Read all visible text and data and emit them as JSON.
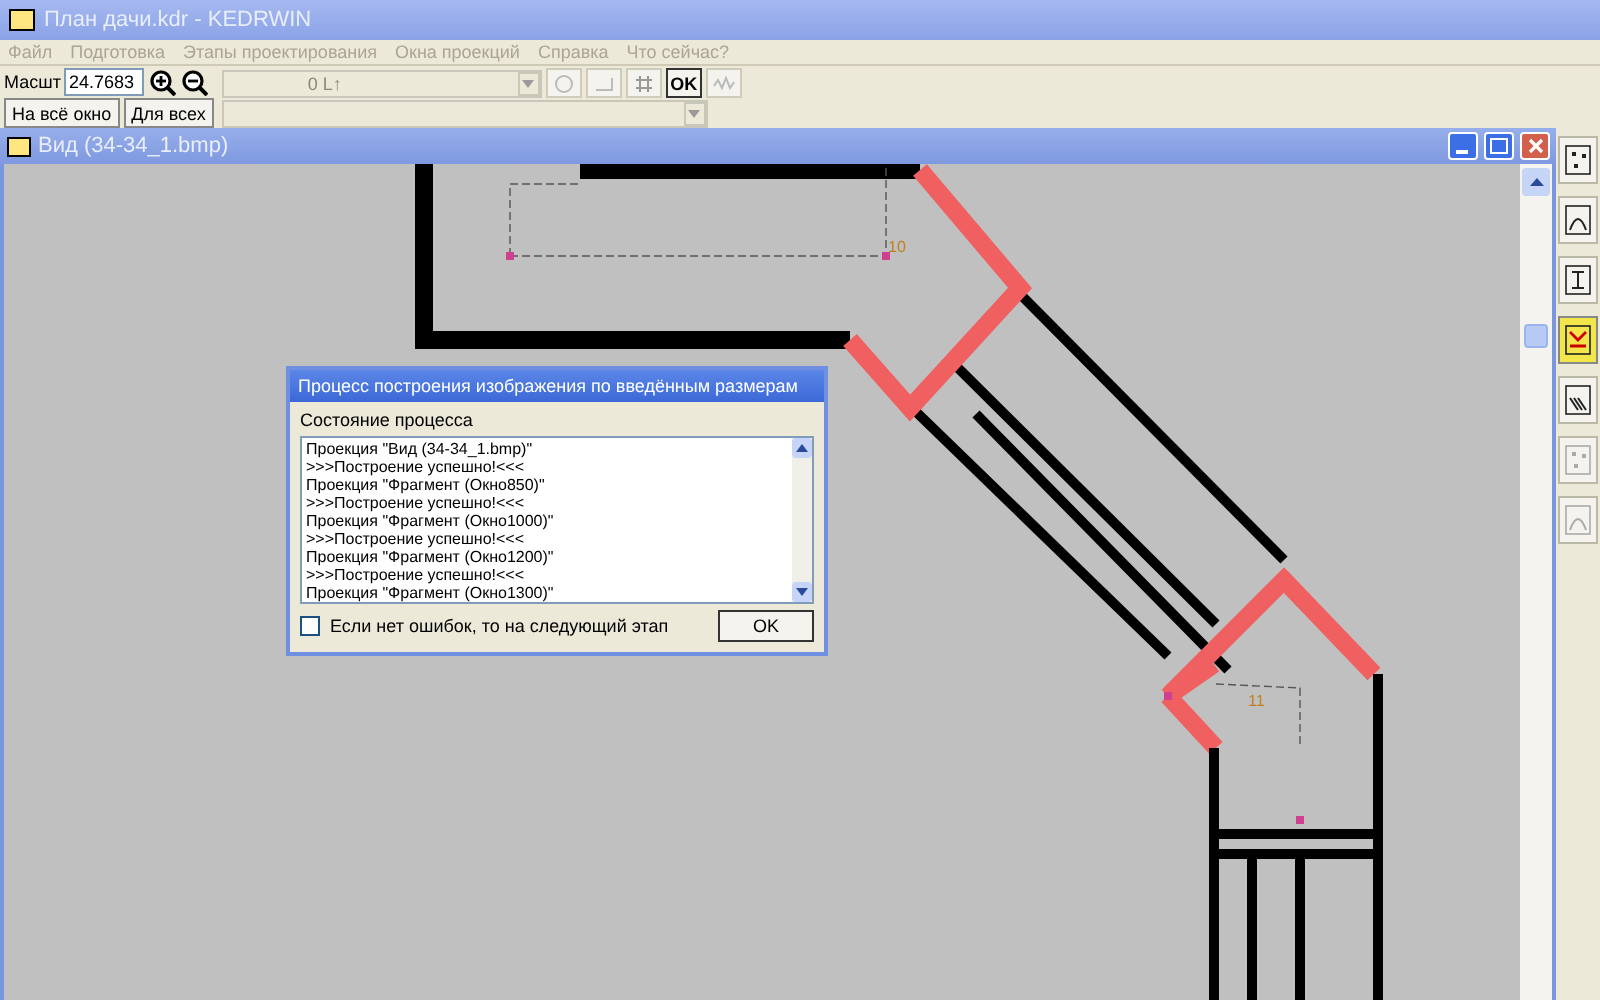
{
  "window": {
    "title": "План дачи.kdr - KEDRWIN"
  },
  "menu": [
    {
      "label": "Файл",
      "disabled": true
    },
    {
      "label": "Подготовка",
      "disabled": true
    },
    {
      "label": "Этапы проектирования",
      "disabled": true
    },
    {
      "label": "Окна проекций",
      "disabled": true
    },
    {
      "label": "Справка",
      "disabled": true
    },
    {
      "label": "Что сейчас?",
      "disabled": true
    }
  ],
  "toolbar": {
    "scale_label": "Масшт",
    "scale_value": "24.7683",
    "fit_button": "На всё окно",
    "all_button": "Для всех",
    "combo_value": "0 L↑",
    "ok_button": "OK"
  },
  "child_window": {
    "title": "Вид (34-34_1.bmp)"
  },
  "canvas_labels": [
    "10",
    "11"
  ],
  "dialog": {
    "title": "Процесс построения изображения по введённым размерам",
    "group_label": "Состояние процесса",
    "log": [
      "Проекция \"Вид (34-34_1.bmp)\"",
      ">>>Построение успешно!<<<",
      "Проекция \"Фрагмент (Окно850)\"",
      ">>>Построение успешно!<<<",
      "Проекция \"Фрагмент (Окно1000)\"",
      ">>>Построение успешно!<<<",
      "Проекция \"Фрагмент (Окно1200)\"",
      ">>>Построение успешно!<<<",
      "Проекция \"Фрагмент (Окно1300)\""
    ],
    "checkbox": {
      "label": "Если нет ошибок, то на следующий этап",
      "checked": false
    },
    "ok_button": "OK"
  },
  "steps": [
    {
      "selected": false,
      "disabled": false
    },
    {
      "selected": false,
      "disabled": false
    },
    {
      "selected": false,
      "disabled": false
    },
    {
      "selected": true,
      "disabled": false
    },
    {
      "selected": false,
      "disabled": false
    },
    {
      "selected": false,
      "disabled": true
    },
    {
      "selected": false,
      "disabled": true
    }
  ]
}
